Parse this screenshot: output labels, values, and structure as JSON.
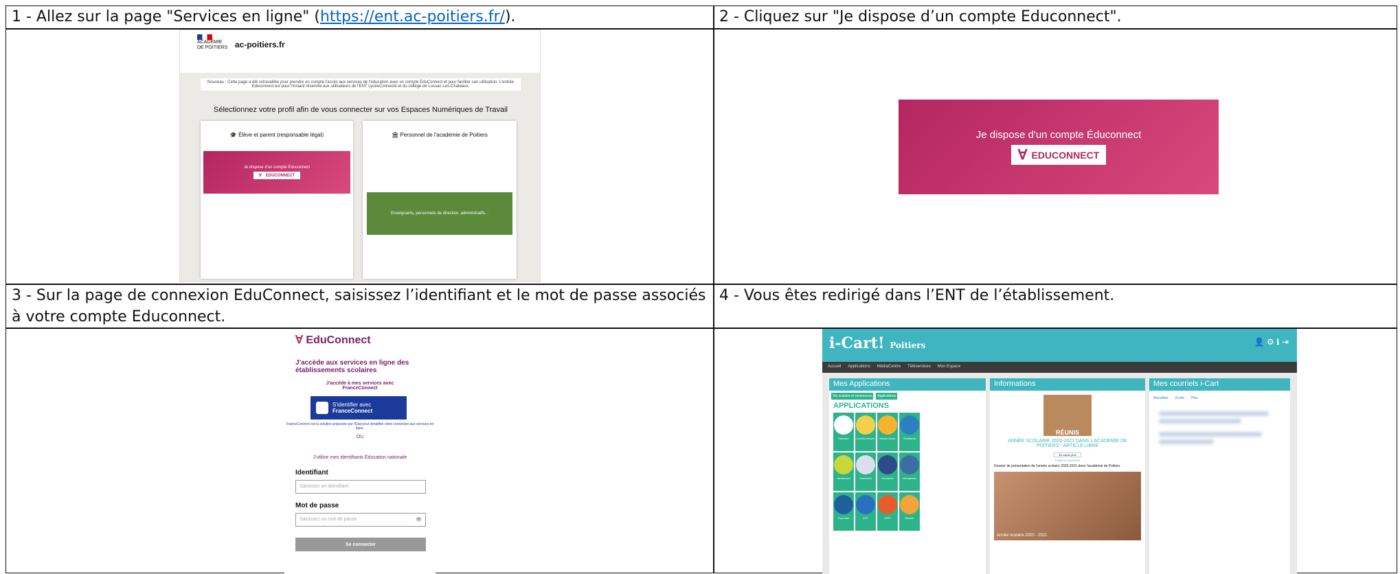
{
  "steps": {
    "s1": {
      "text": "1 - Allez sur la page \"Services en ligne\" (",
      "link": "https://ent.ac-poitiers.fr/",
      "tail": ")."
    },
    "s2": "2 - Cliquez sur \"Je dispose d’un compte Educonnect\".",
    "s3": "3 - Sur la page de connexion EduConnect, saisissez l’identifiant et le mot de passe associés à votre compte Educonnect.",
    "s4": "4 - Vous êtes redirigé dans l’ENT de l’établissement."
  },
  "shot1": {
    "academie": "ACADÉMIE\nDE POITIERS",
    "site": "ac-poitiers.fr",
    "notice": "Nouveau : Cette page a été retravaillée pour prendre en compte l'accès aux services de l'éducation avec un compte EduConnect et pour faciliter son utilisation. L'entrée Educonnect est pour l'instant réservée aux utilisateurs de l'ENT LycéeConnecté et du collège de Lussac-Les-Chateaux.",
    "heading": "Sélectionnez votre profil afin de vous connecter sur vos Espaces Numériques de Travail",
    "profile1": "Élève et parent (responsable légal)",
    "profile2": "Personnel de l'académie de Poitiers",
    "educonnect_btn": "Je dispose d'un compte Éduconnect",
    "educonnect_logo": "EDUCONNECT",
    "staff_btn": "Enseignants, personnels de direction, administratifs..."
  },
  "shot2": {
    "btn": "Je dispose d'un compte Éduconnect",
    "logo": "EDUCONNECT"
  },
  "shot3": {
    "brand": "EduConnect",
    "title": "J'accède aux services en ligne des établissements scolaires",
    "fc_intro": "J'accède à mes services avec FranceConnect",
    "fc_btn1": "S'identifier avec",
    "fc_btn2": "FranceConnect",
    "fc_note": "FranceConnect est la solution proposée par l'État pour simplifier votre connexion aux services en ligne.",
    "or": "OU",
    "edu_id": "J'utilise mes identifiants Éducation nationale",
    "id_label": "Identifiant",
    "id_placeholder": "Saisissez un identifiant",
    "pw_label": "Mot de passe",
    "pw_placeholder": "Saisissez un mot de passe",
    "submit": "Se connecter"
  },
  "shot4": {
    "logo": "i-Cart!",
    "region": "Poitiers",
    "nav": [
      "Accueil",
      "Applications",
      "MédiaCentre",
      "Téléservices",
      "Mon Espace"
    ],
    "panel1": "Mes Applications",
    "panel2": "Informations",
    "panel3": "Mes courriels i-Cart",
    "sub_tabs": [
      "Vie scolaire et ressources",
      "Applications"
    ],
    "apps_heading": "APPLICATIONS",
    "apps": [
      "Kairrand",
      "LimeSurveyAc",
      "Monde Acad.",
      "Sholidrout",
      "Newbearrd",
      "Owncloud",
      "eConnect",
      "Wordpress",
      "Pop Data",
      "CDT",
      "GEPI",
      "Moodle"
    ],
    "news_badge": "RÉUNIS",
    "news_title": "ANNÉE SCOLAIRE 2020-2021 DANS L'ACADÉMIE DE POITIERS - ARTICLE LIBRE",
    "news_more": "En savoir plus",
    "news_date": "Publié le 01/09/2020",
    "news_desc": "Dossier de présentation de l'année scolaire 2020-2021 dans l'académie de Poitiers.",
    "photo_caption": "Année scolaire 2020 - 2021",
    "mail_actions": [
      "Actualiser",
      "Écrire",
      "Plus"
    ],
    "colors": {
      "teal": "#3fb6bf",
      "app_green": "#2db38a",
      "dark": "#3b3b3b"
    }
  }
}
